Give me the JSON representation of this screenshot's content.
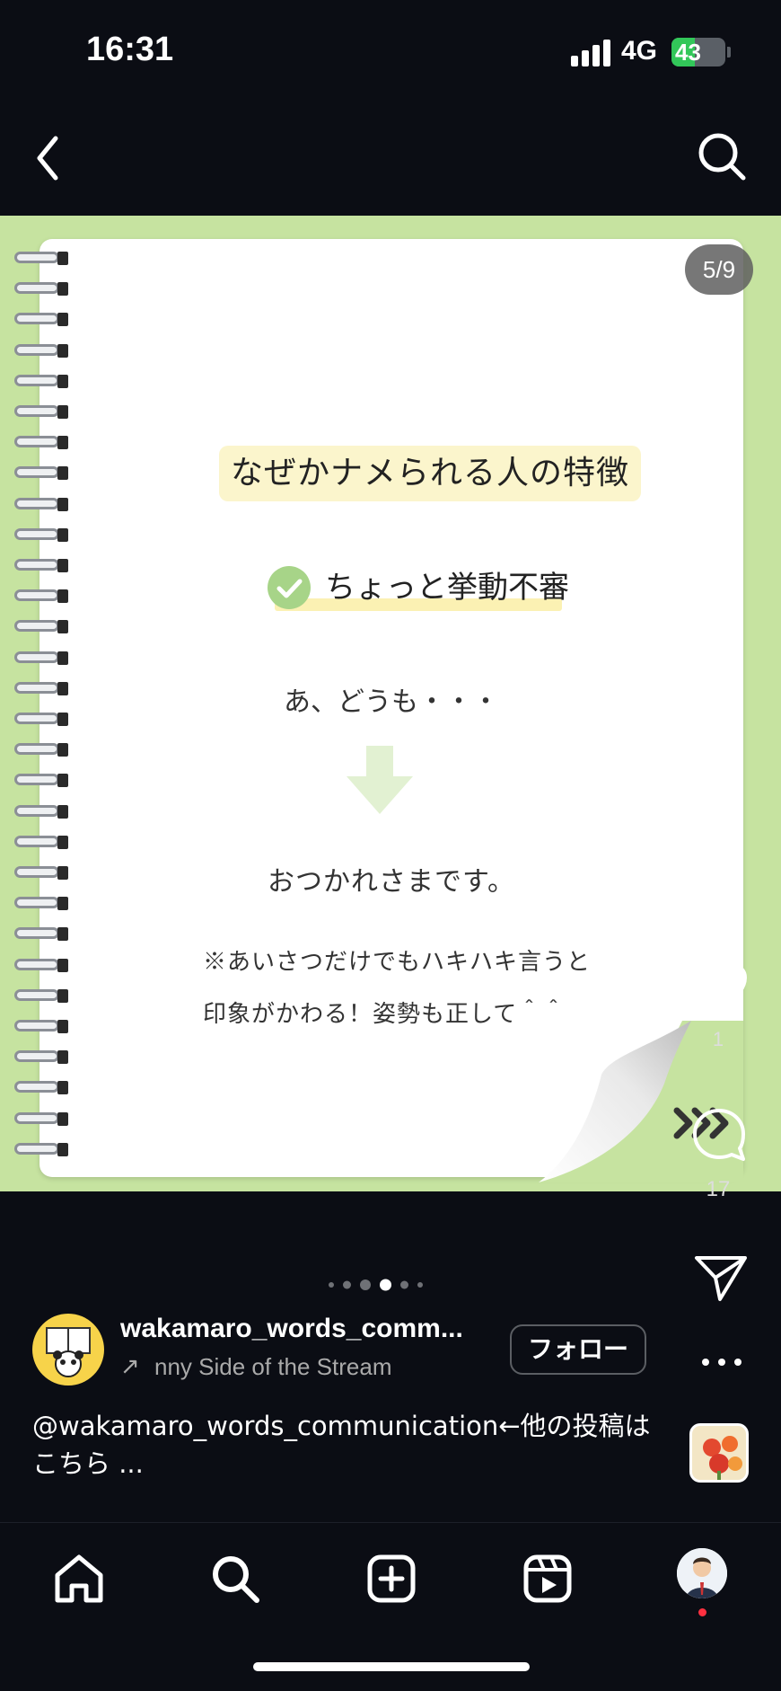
{
  "status_bar": {
    "time": "16:31",
    "network": "4G",
    "battery": "43",
    "battery_level": 0.43
  },
  "post": {
    "counter": "5/9",
    "title": "なぜかナメられる人の特徴",
    "point": "ちょっと挙動不審",
    "greeting": "あ、どうも・・・",
    "reply": "おつかれさまです。",
    "note_line1": "※あいさつだけでもハキハキ言うと",
    "note_line2": "印象がかわる！姿勢も正して＾＾",
    "colors": {
      "background": "#c6e3a0",
      "paper": "#ffffff",
      "accent_green": "#a7d488",
      "highlight_yellow": "#fbf5cc"
    }
  },
  "pagination": {
    "total": 6,
    "active_index": 3
  },
  "actions": {
    "like_count": "1",
    "comment_count": "17"
  },
  "author": {
    "username": "wakamaro_words_comm...",
    "audio_title": "nny Side of the Stream",
    "follow_label": "フォロー"
  },
  "caption": {
    "text": "@wakamaro_words_communication←他の投稿はこちら ..."
  },
  "tabs": [
    "home-icon",
    "search-icon",
    "create-icon",
    "reels-icon",
    "profile-avatar"
  ]
}
